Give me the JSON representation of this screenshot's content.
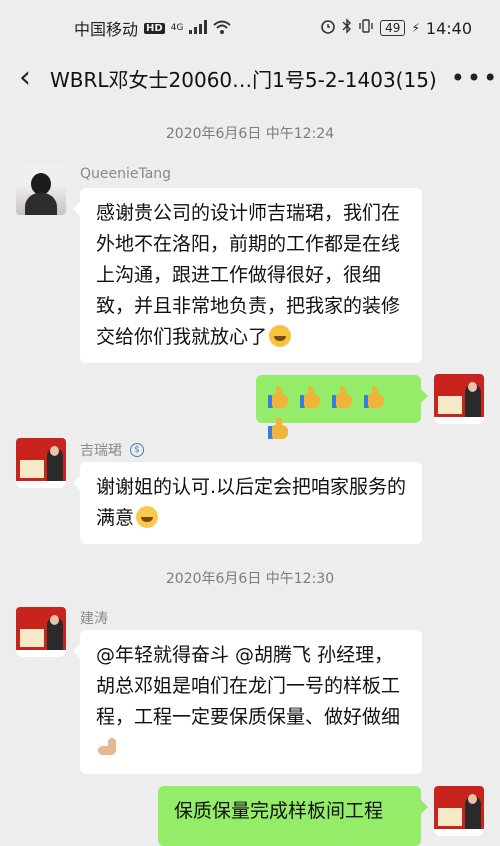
{
  "status_bar": {
    "carrier": "中国移动",
    "hd": "HD",
    "net": "4G",
    "battery": "49",
    "time": "14:40"
  },
  "header": {
    "title": "WBRL邓女士20060…门1号5-2-1403(15)",
    "back_icon": "chevron-left-icon",
    "more_icon": "more-dots-icon"
  },
  "messages": [
    {
      "type": "timestamp",
      "text": "2020年6月6日 中午12:24"
    },
    {
      "type": "incoming",
      "sender": "QueenieTang",
      "text": "感谢贵公司的设计师吉瑞珺，我们在外地不在洛阳，前期的工作都是在线上沟通，跟进工作做得很好，很细致，并且非常地负责，把我家的装修交给你们我就放心了",
      "emoji": "grin-emoji"
    },
    {
      "type": "outgoing",
      "thumbs": 5,
      "emoji": "thumbs-up-emoji"
    },
    {
      "type": "incoming",
      "sender": "吉瑞珺",
      "text": "谢谢姐的认可.以后定会把咱家服务的满意",
      "emoji": "blush-emoji"
    },
    {
      "type": "timestamp",
      "text": "2020年6月6日 中午12:30"
    },
    {
      "type": "incoming",
      "sender": "建涛",
      "text": "@年轻就得奋斗 @胡腾飞  孙经理，胡总邓姐是咱们在龙门一号的样板工程，工程一定要保质保量、做好做细",
      "emoji": "muscle-emoji"
    },
    {
      "type": "outgoing",
      "text": "保质保量完成样板间工程"
    }
  ]
}
